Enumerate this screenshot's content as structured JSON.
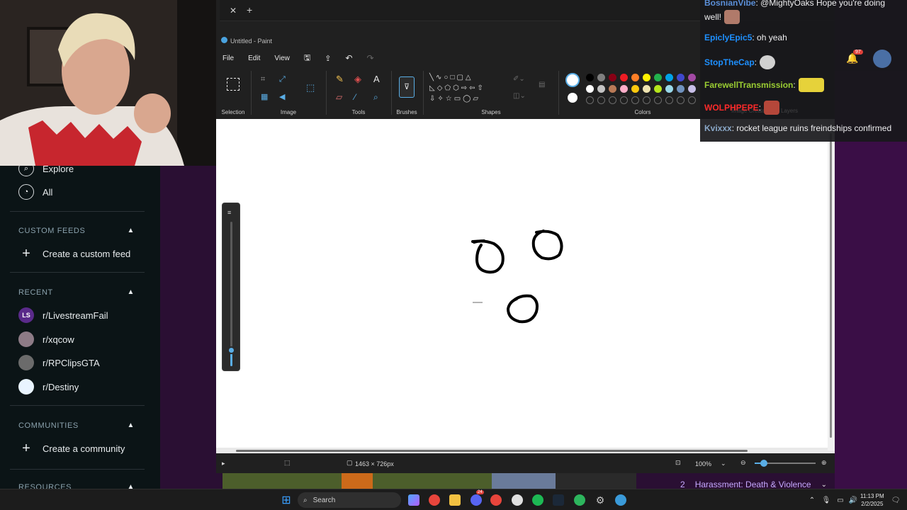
{
  "reddit": {
    "nav": [
      {
        "label": "Explore"
      },
      {
        "label": "All"
      }
    ],
    "custom_feeds": {
      "heading": "CUSTOM FEEDS",
      "create_label": "Create a custom feed"
    },
    "recent": {
      "heading": "RECENT",
      "items": [
        {
          "label": "r/LivestreamFail",
          "avatar": "LS"
        },
        {
          "label": "r/xqcow",
          "avatar": ""
        },
        {
          "label": "r/RPClipsGTA",
          "avatar": ""
        },
        {
          "label": "r/Destiny",
          "avatar": ""
        }
      ]
    },
    "communities": {
      "heading": "COMMUNITIES",
      "create_label": "Create a community"
    },
    "resources": {
      "heading": "RESOURCES"
    }
  },
  "paint": {
    "title": "Untitled - Paint",
    "menu": {
      "file": "File",
      "edit": "Edit",
      "view": "View"
    },
    "ribbon": {
      "selection": "Selection",
      "image": "Image",
      "tools": "Tools",
      "brushes": "Brushes",
      "shapes": "Shapes",
      "colors": "Colors"
    },
    "colors_row1": [
      "#000000",
      "#7f7f7f",
      "#880015",
      "#ed1c24",
      "#ff7f27",
      "#fff200",
      "#22b14c",
      "#00a2e8",
      "#3f48cc",
      "#a349a4"
    ],
    "colors_row2": [
      "#ffffff",
      "#c3c3c3",
      "#b97a57",
      "#ffaec9",
      "#ffc90e",
      "#efe4b0",
      "#b5e61d",
      "#99d9ea",
      "#7092be",
      "#c8bfe7"
    ],
    "status": {
      "canvas_size": "1463 × 726px",
      "zoom": "100%"
    }
  },
  "chat": {
    "messages": [
      {
        "user": "BosnianVibe",
        "color": "#5b8fd8",
        "text": ": @MightyOaks Hope you're doing"
      },
      {
        "user": "",
        "color": "#efeff1",
        "text": "well!"
      },
      {
        "user": "EpiclyEpic5",
        "color": "#1e90ff",
        "text": ": oh yeah"
      },
      {
        "user": "StopTheCap",
        "color": "#1e90ff",
        "text": ":"
      },
      {
        "user": "FarewellTransmission",
        "color": "#9acd32",
        "text": ":"
      },
      {
        "user": "WOLPHPEPE",
        "color": "#ff2a2a",
        "text": ":"
      },
      {
        "user": "Kvixxx",
        "color": "#8aa8c8",
        "text": ": rocket league ruins freindships confirmed"
      }
    ],
    "notification_count": "97",
    "ghost_labels": {
      "image_creator": "Image Creator",
      "layers": "Layers"
    }
  },
  "stream": {
    "rules_item_number": "2",
    "rules_item_label": "Harassment: Death & Violence"
  },
  "taskbar": {
    "search_label": "Search",
    "time": "11:13 PM",
    "date": "2/2/2025",
    "discord_badge": "24"
  }
}
